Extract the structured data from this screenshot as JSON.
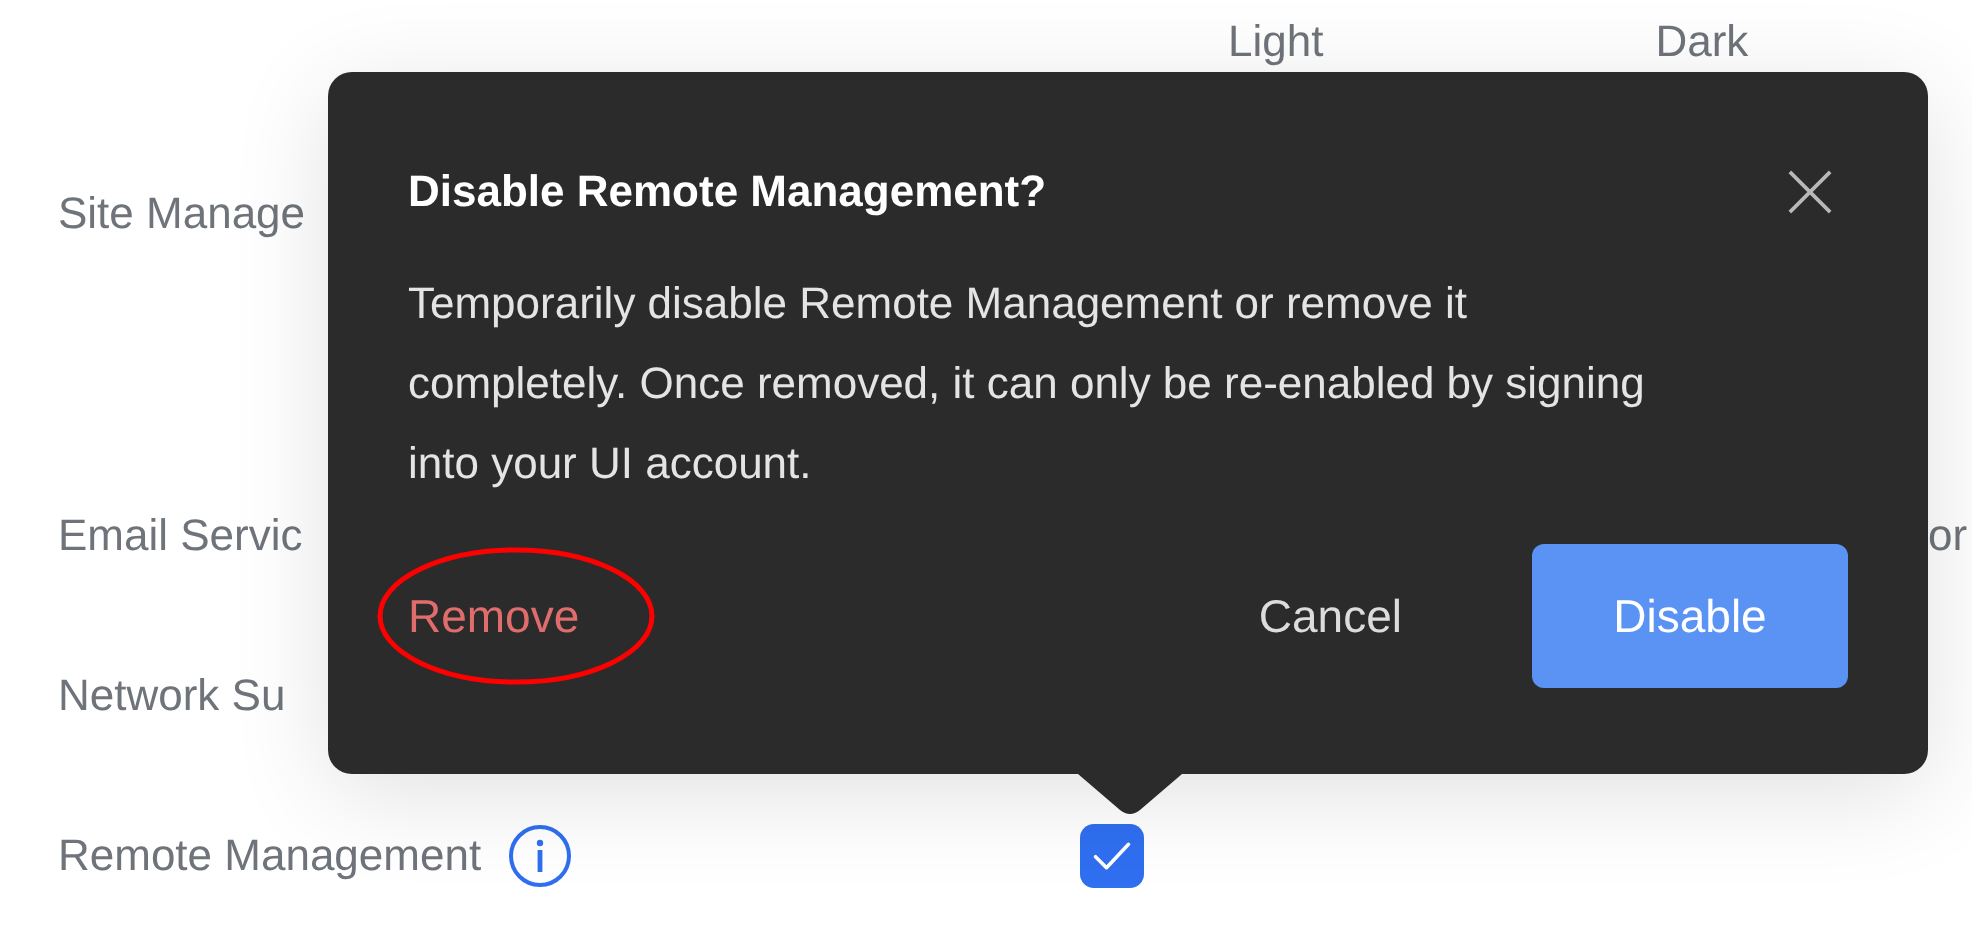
{
  "settings_table": {
    "columns": [
      "Light",
      "Dark"
    ],
    "rows": [
      {
        "label": "Site Manage"
      },
      {
        "label": "Email Servic",
        "column_3": "or"
      },
      {
        "label": "Network Su"
      },
      {
        "label": "Remote Management",
        "info": true,
        "checked": true
      }
    ]
  },
  "dialog": {
    "title": "Disable Remote Management?",
    "body": "Temporarily disable Remote Management or remove it completely. Once removed, it can only be re-enabled by signing into your UI account.",
    "buttons": [
      {
        "label": "Remove",
        "kind": "danger",
        "highlighted": true
      },
      {
        "label": "Cancel",
        "kind": "text",
        "highlighted": false
      },
      {
        "label": "Disable",
        "kind": "primary",
        "highlighted": false
      }
    ]
  }
}
